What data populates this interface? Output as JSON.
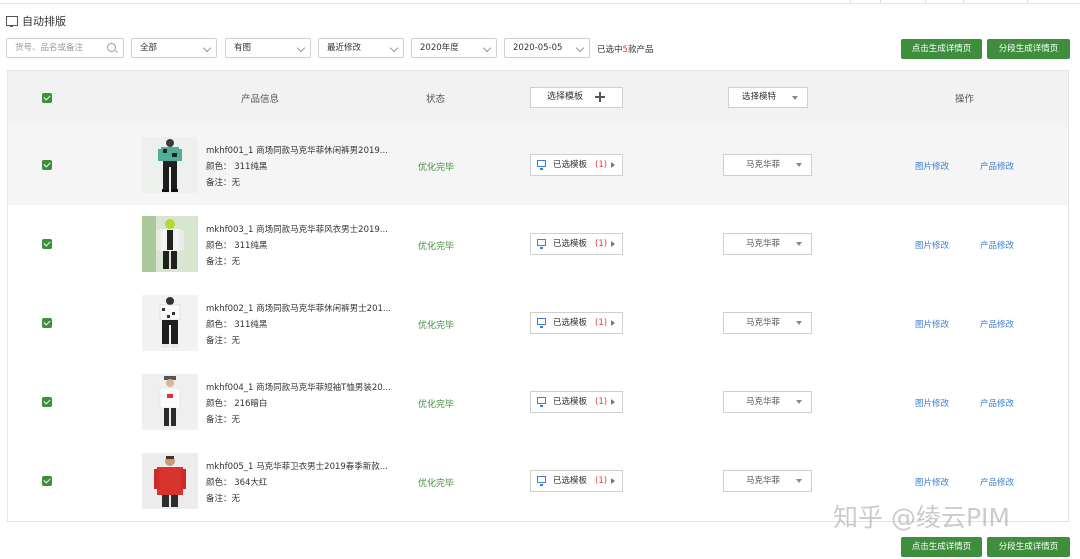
{
  "page": {
    "title": "自动排版"
  },
  "filters": {
    "search_placeholder": "货号、品名或备注",
    "category": "全部",
    "image_filter": "有图",
    "sort": "最近修改",
    "year": "2020年度",
    "date": "2020-05-05",
    "selected_prefix": "已选中",
    "selected_count": "5",
    "selected_suffix": "款产品"
  },
  "actions": {
    "generate_detail": "点击生成详情页",
    "generate_segmented": "分段生成详情页"
  },
  "table": {
    "headers": {
      "product_info": "产品信息",
      "status": "状态",
      "select_template": "选择模板",
      "select_model": "选择模特",
      "operation": "操作"
    },
    "rows": [
      {
        "name": "mkhf001_1 商场同款马克华菲休闲裤男2019...",
        "color": "颜色： 311纯黑",
        "note": "备注：无",
        "status": "优化完毕",
        "template_label": "已选模板",
        "template_count": "(1)",
        "model": "马克华菲",
        "edit_image": "图片修改",
        "edit_product": "产品修改"
      },
      {
        "name": "mkhf003_1 商场同款马克华菲风衣男士2019...",
        "color": "颜色： 311纯黑",
        "note": "备注：无",
        "status": "优化完毕",
        "template_label": "已选模板",
        "template_count": "(1)",
        "model": "马克华菲",
        "edit_image": "图片修改",
        "edit_product": "产品修改"
      },
      {
        "name": "mkhf002_1 商场同款马克华菲休闲裤男士201...",
        "color": "颜色： 311纯黑",
        "note": "备注：无",
        "status": "优化完毕",
        "template_label": "已选模板",
        "template_count": "(1)",
        "model": "马克华菲",
        "edit_image": "图片修改",
        "edit_product": "产品修改"
      },
      {
        "name": "mkhf004_1 商场同款马克华菲短袖T恤男装20...",
        "color": "颜色： 216暗白",
        "note": "备注：无",
        "status": "优化完毕",
        "template_label": "已选模板",
        "template_count": "(1)",
        "model": "马克华菲",
        "edit_image": "图片修改",
        "edit_product": "产品修改"
      },
      {
        "name": "mkhf005_1 马克华菲卫衣男士2019春季新款...",
        "color": "颜色： 364大红",
        "note": "备注：无",
        "status": "优化完毕",
        "template_label": "已选模板",
        "template_count": "(1)",
        "model": "马克华菲",
        "edit_image": "图片修改",
        "edit_product": "产品修改"
      }
    ]
  },
  "watermark": "知乎 @绫云PIM",
  "colors": {
    "accent_green": "#3e8e3e",
    "link_blue": "#3b7ed6",
    "count_red": "#e53935"
  }
}
